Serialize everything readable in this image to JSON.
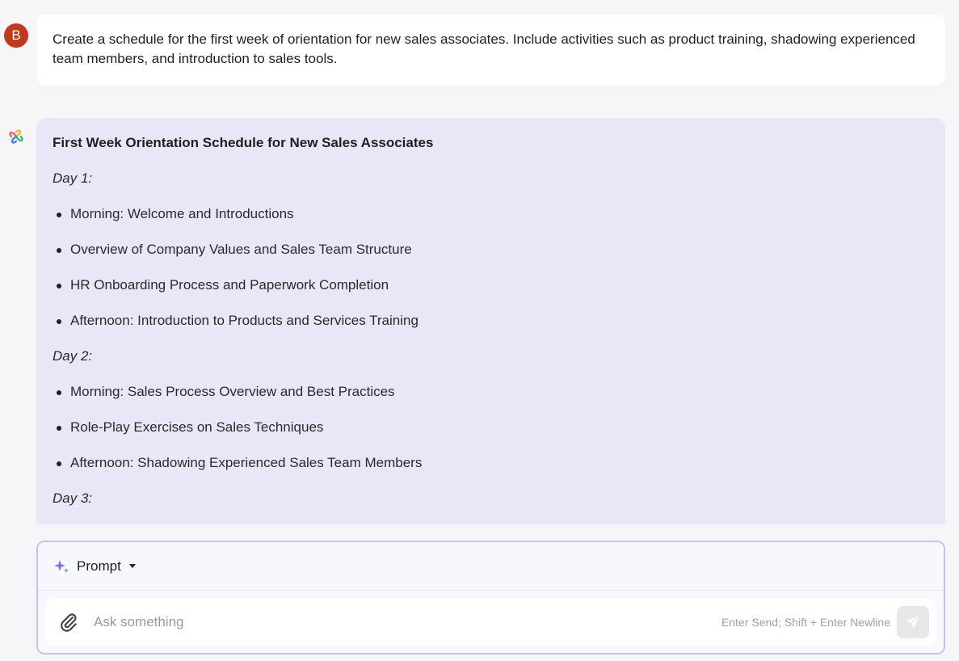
{
  "user": {
    "avatar_initial": "B",
    "message": "Create a schedule for the first week of orientation for new sales associates. Include activities such as product training, shadowing experienced team members, and introduction to sales tools."
  },
  "response": {
    "title": "First Week Orientation Schedule for New Sales Associates",
    "days": [
      {
        "label": "Day 1:",
        "items": [
          "Morning: Welcome and Introductions",
          "Overview of Company Values and Sales Team Structure",
          "HR Onboarding Process and Paperwork Completion",
          "Afternoon: Introduction to Products and Services Training"
        ]
      },
      {
        "label": "Day 2:",
        "items": [
          "Morning: Sales Process Overview and Best Practices",
          "Role-Play Exercises on Sales Techniques",
          "Afternoon: Shadowing Experienced Sales Team Members"
        ]
      },
      {
        "label": "Day 3:",
        "items": []
      }
    ]
  },
  "composer": {
    "mode_label": "Prompt",
    "placeholder": "Ask something",
    "hint": "Enter Send; Shift + Enter Newline"
  },
  "colors": {
    "avatar": "#c0391b",
    "assistant_bubble": "#e9e7f7",
    "composer_border": "#c5c2ef"
  },
  "icons": [
    "assistant-logo-icon",
    "sparkle-icon",
    "chevron-down-icon",
    "paperclip-icon",
    "send-icon"
  ]
}
